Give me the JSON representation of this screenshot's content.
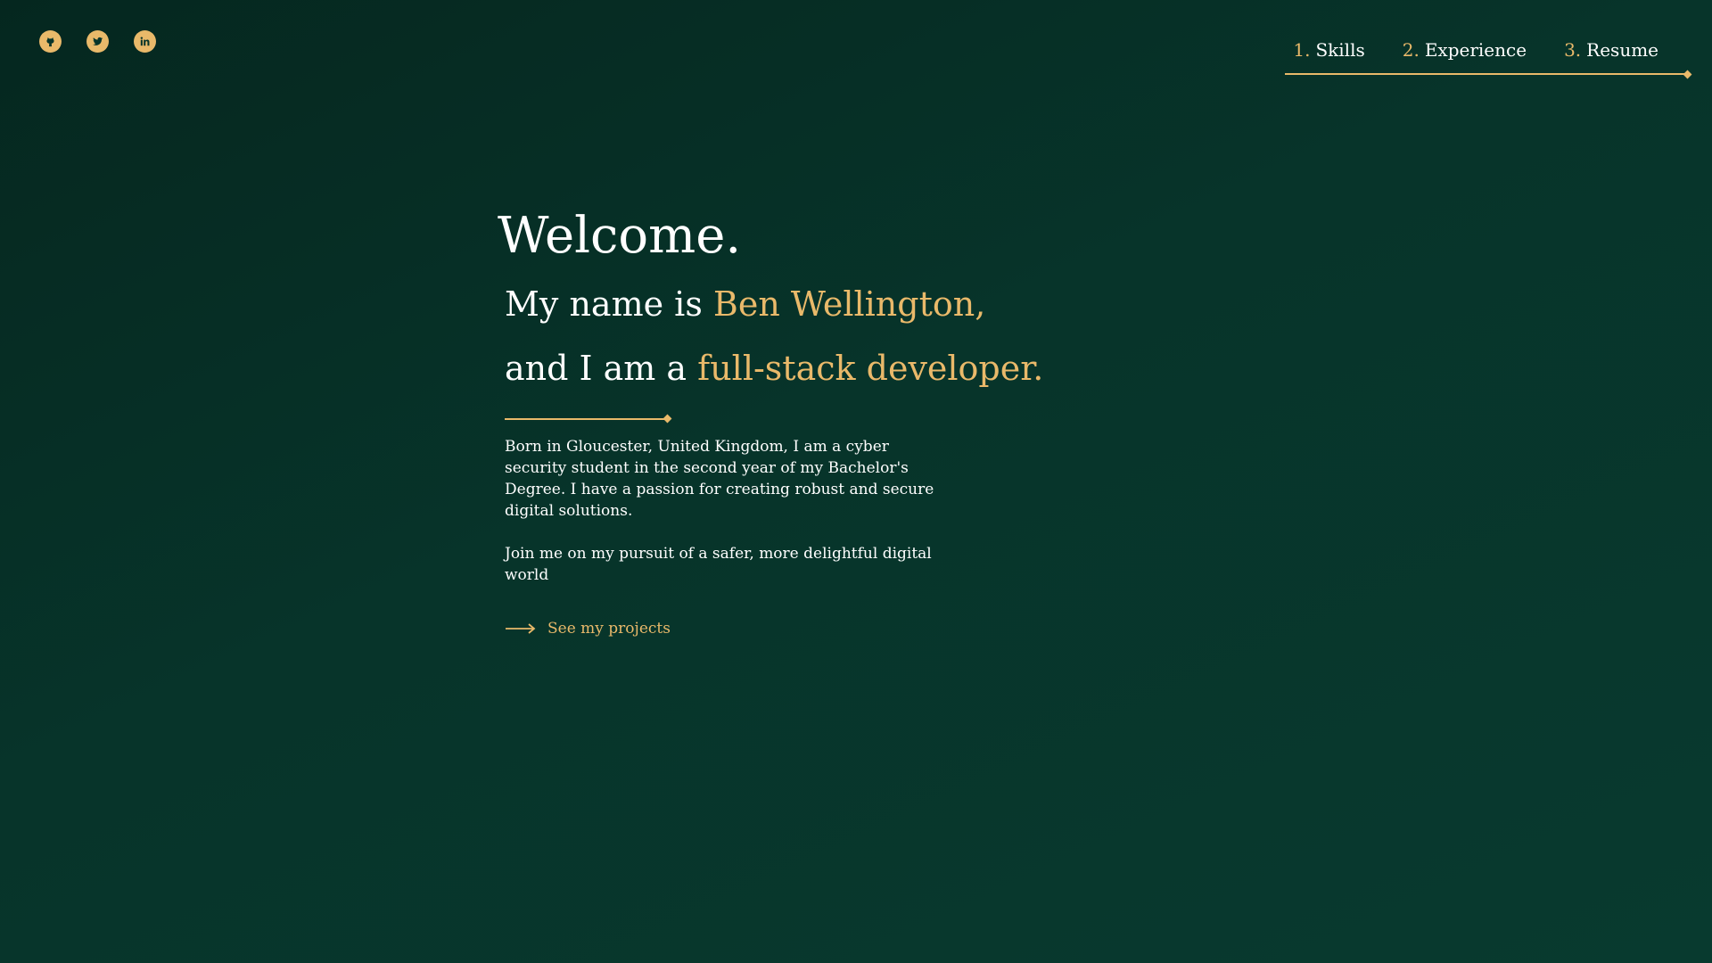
{
  "social": [
    {
      "name": "github-icon"
    },
    {
      "name": "twitter-icon"
    },
    {
      "name": "linkedin-icon"
    }
  ],
  "nav": {
    "items": [
      {
        "num": "1.",
        "label": "Skills"
      },
      {
        "num": "2.",
        "label": "Experience"
      },
      {
        "num": "3.",
        "label": "Resume"
      }
    ]
  },
  "hero": {
    "welcome": "Welcome.",
    "line1_prefix": "My name is ",
    "line1_highlight": "Ben Wellington,",
    "line2_prefix": "and I am a ",
    "line2_highlight": "full-stack developer.",
    "bio": [
      "Born in Gloucester, United Kingdom, I am a cyber security student in the second year of my Bachelor's Degree. I have a passion for creating robust and secure digital solutions.",
      "Join me on my pursuit of a safer, more delightful digital world"
    ],
    "cta_label": "See my  projects"
  },
  "colors": {
    "accent": "#e9b96a",
    "background": "#07342a",
    "text": "#ffffff"
  }
}
